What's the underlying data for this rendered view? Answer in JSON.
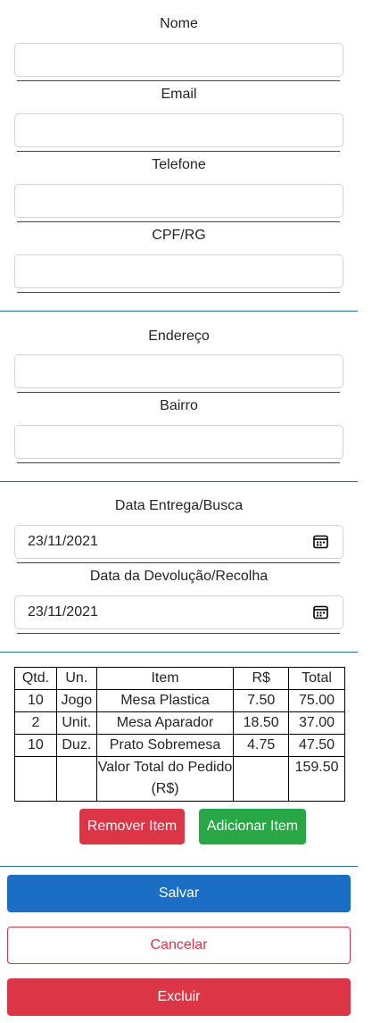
{
  "form": {
    "nome_label": "Nome",
    "email_label": "Email",
    "telefone_label": "Telefone",
    "cpf_label": "CPF/RG",
    "endereco_label": "Endereço",
    "bairro_label": "Bairro",
    "data_entrega_label": "Data Entrega/Busca",
    "data_entrega_value": "23/11/2021",
    "data_devolucao_label": "Data da Devolução/Recolha",
    "data_devolucao_value": "23/11/2021"
  },
  "table": {
    "headers": [
      "Qtd.",
      "Un.",
      "Item",
      "R$",
      "Total"
    ],
    "rows": [
      [
        "10",
        "Jogo",
        "Mesa Plastica",
        "7.50",
        "75.00"
      ],
      [
        "2",
        "Unit.",
        "Mesa Aparador",
        "18.50",
        "37.00"
      ],
      [
        "10",
        "Duz.",
        "Prato Sobremesa",
        "4.75",
        "47.50"
      ]
    ],
    "total_label": "Valor Total do Pedido (R$)",
    "total_value": "159.50"
  },
  "buttons": {
    "remover": "Remover Item",
    "adicionar": "Adicionar Item",
    "salvar": "Salvar",
    "cancelar": "Cancelar",
    "excluir": "Excluir"
  },
  "colors": {
    "primary": "#1a6fc4",
    "danger": "#dc3545",
    "success": "#28a745"
  }
}
